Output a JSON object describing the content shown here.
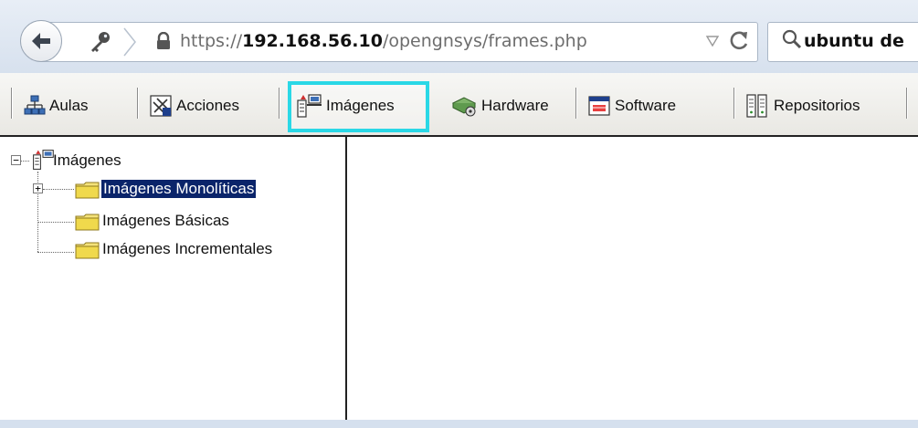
{
  "browser": {
    "url_prefix": "https://",
    "url_host": "192.168.56.10",
    "url_path": "/opengnsys/frames.php",
    "search_value": "ubuntu de",
    "icons": {
      "back": "back-arrow-icon",
      "site": "key-icon",
      "lock": "lock-icon",
      "dropdown": "dropdown-triangle-icon",
      "reload": "reload-icon",
      "search": "search-icon"
    }
  },
  "toolbar": {
    "items": [
      {
        "id": "aulas",
        "label": "Aulas",
        "icon": "network-icon"
      },
      {
        "id": "acciones",
        "label": "Acciones",
        "icon": "actions-icon"
      },
      {
        "id": "imagenes",
        "label": "Imágenes",
        "icon": "images-icon",
        "active": true
      },
      {
        "id": "hardware",
        "label": "Hardware",
        "icon": "hardware-icon"
      },
      {
        "id": "software",
        "label": "Software",
        "icon": "software-icon"
      },
      {
        "id": "repositorios",
        "label": "Repositorios",
        "icon": "repository-icon"
      }
    ],
    "highlight_color": "#2ad8e6"
  },
  "tree": {
    "root": {
      "label": "Imágenes",
      "expanded": true
    },
    "children": [
      {
        "label": "Imágenes Monolíticas",
        "selected": true,
        "has_children": true
      },
      {
        "label": "Imágenes Básicas",
        "selected": false,
        "has_children": false
      },
      {
        "label": "Imágenes Incrementales",
        "selected": false,
        "has_children": false
      }
    ],
    "selection_color": "#0a246a"
  }
}
